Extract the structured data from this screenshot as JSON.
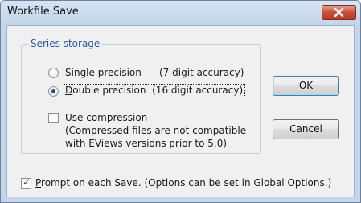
{
  "window": {
    "title": "Workfile Save"
  },
  "series_storage": {
    "legend": "Series storage",
    "single": {
      "mnemonic": "S",
      "rest": "ingle precision",
      "detail": "(7 digit accuracy)",
      "checked": false
    },
    "double": {
      "mnemonic": "D",
      "rest": "ouble precision",
      "detail": "(16 digit accuracy)",
      "checked": true
    },
    "compression": {
      "mnemonic": "U",
      "rest": "se compression",
      "note_line1": "(Compressed files are not compatible",
      "note_line2": "with EViews versions prior to 5.0)",
      "checked": false
    }
  },
  "buttons": {
    "ok": "OK",
    "cancel": "Cancel"
  },
  "prompt": {
    "mnemonic": "P",
    "rest": "rompt on each Save.  (Options can be set in Global Options.)",
    "checked": true
  }
}
